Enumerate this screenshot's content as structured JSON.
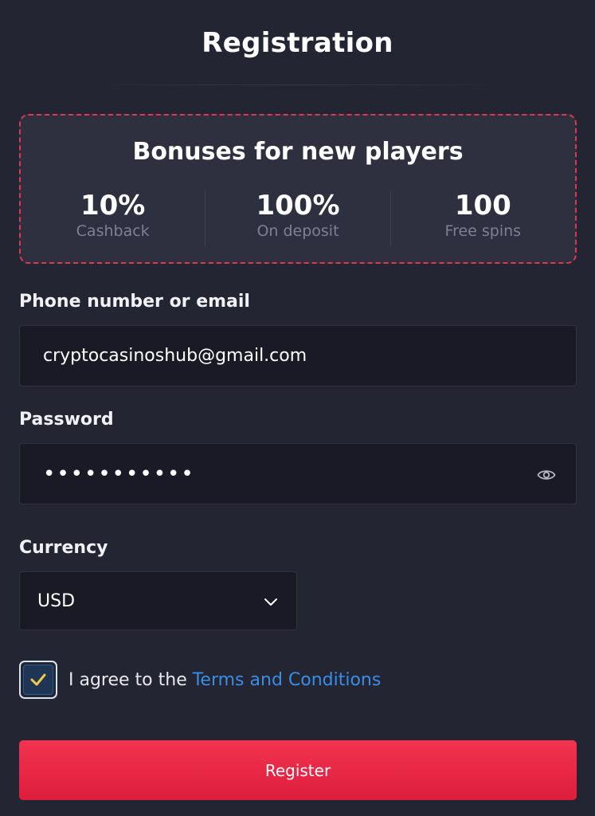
{
  "page": {
    "title": "Registration"
  },
  "bonus": {
    "title": "Bonuses for new players",
    "stats": [
      {
        "value": "10%",
        "label": "Cashback"
      },
      {
        "value": "100%",
        "label": "On deposit"
      },
      {
        "value": "100",
        "label": "Free spins"
      }
    ],
    "border_color": "#e2374f"
  },
  "form": {
    "contact_label": "Phone number or email",
    "contact_value": "cryptocasinoshub@gmail.com",
    "password_label": "Password",
    "password_value": "•••••••••••",
    "currency_label": "Currency",
    "currency_value": "USD",
    "agree_checked": true,
    "agree_text": "I agree to the ",
    "terms_link": "Terms and Conditions",
    "register_label": "Register"
  },
  "icons": {
    "password_toggle": "eye-icon",
    "currency_dropdown": "chevron-down-icon",
    "checkbox_mark": "check-icon"
  },
  "colors": {
    "background": "#242533",
    "accent": "#ef2a47",
    "link": "#3a8de6",
    "checkmark": "#f2c94c"
  }
}
